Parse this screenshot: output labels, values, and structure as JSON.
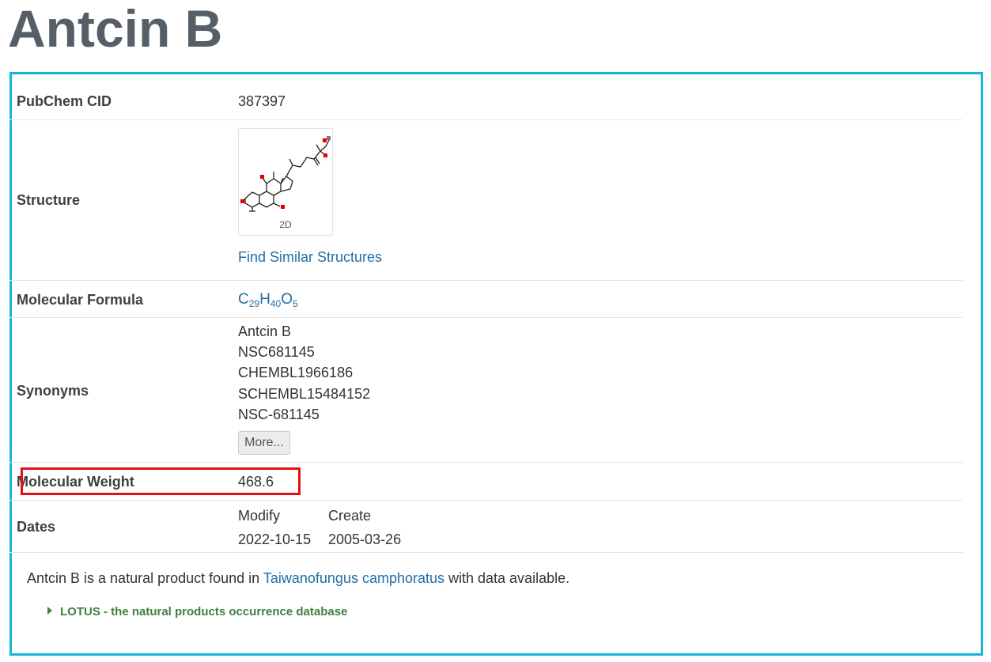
{
  "page": {
    "title": "Antcin B"
  },
  "rows": {
    "pubchem_cid": {
      "label": "PubChem CID",
      "value": "387397"
    },
    "structure": {
      "label": "Structure",
      "caption": "2D",
      "link": "Find Similar Structures"
    },
    "formula": {
      "label": "Molecular Formula",
      "parts": [
        "C",
        "29",
        "H",
        "40",
        "O",
        "5"
      ]
    },
    "synonyms": {
      "label": "Synonyms",
      "items": [
        "Antcin B",
        "NSC681145",
        "CHEMBL1966186",
        "SCHEMBL15484152",
        "NSC-681145"
      ],
      "more_button": "More..."
    },
    "molecular_weight": {
      "label": "Molecular Weight",
      "value": "468.6"
    },
    "dates": {
      "label": "Dates",
      "modify_label": "Modify",
      "create_label": "Create",
      "modify_value": "2022-10-15",
      "create_value": "2005-03-26"
    }
  },
  "description": {
    "before": "Antcin B is a natural product found in ",
    "organism_link": "Taiwanofungus camphoratus",
    "after": " with data available."
  },
  "source_link": "LOTUS - the natural products occurrence database",
  "colors": {
    "box_border": "#13b8d9",
    "highlight": "#e0101a",
    "link": "#206fa6",
    "lotus": "#3f7f3f"
  }
}
